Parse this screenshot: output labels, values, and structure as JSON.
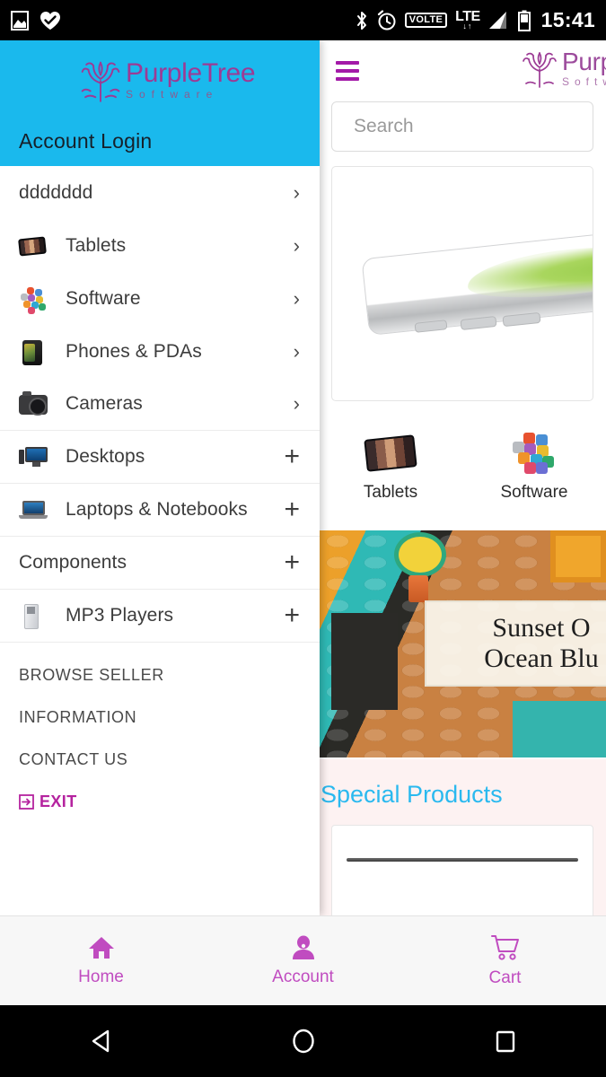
{
  "status_bar": {
    "left_icons": [
      "image-icon",
      "heart-check-icon"
    ],
    "right_icons": [
      "bluetooth-icon",
      "alarm-icon",
      "volte-badge",
      "lte-icon",
      "signal-icon",
      "battery-icon"
    ],
    "volte_label": "VOLTE",
    "lte_label": "LTE",
    "lte_arrows": "↓↑",
    "clock": "15:41"
  },
  "drawer": {
    "logo": {
      "main": "PurpleTree",
      "sub": "Software",
      "icon": "tree-logo-icon"
    },
    "account_login_label": "Account Login",
    "menu_items": [
      {
        "label": "ddddddd",
        "icon": "",
        "action": "chevron",
        "divider": false
      },
      {
        "label": "Tablets",
        "icon": "tablet-thumb-icon",
        "action": "chevron",
        "divider": false
      },
      {
        "label": "Software",
        "icon": "software-thumb-icon",
        "action": "chevron",
        "divider": false
      },
      {
        "label": "Phones & PDAs",
        "icon": "phone-thumb-icon",
        "action": "chevron",
        "divider": false
      },
      {
        "label": "Cameras",
        "icon": "camera-thumb-icon",
        "action": "chevron",
        "divider": true
      },
      {
        "label": "Desktops",
        "icon": "desktop-thumb-icon",
        "action": "plus",
        "divider": true
      },
      {
        "label": "Laptops & Notebooks",
        "icon": "laptop-thumb-icon",
        "action": "plus",
        "divider": true
      },
      {
        "label": "Components",
        "icon": "",
        "action": "plus",
        "divider": true
      },
      {
        "label": "MP3 Players",
        "icon": "mp3-thumb-icon",
        "action": "plus",
        "divider": true
      }
    ],
    "links": [
      "BROWSE SELLER",
      "INFORMATION",
      "CONTACT US"
    ],
    "exit_label": "EXIT",
    "exit_icon": "exit-arrow-icon",
    "header_bg": "#1ab9ed",
    "exit_color": "#b5239f"
  },
  "main": {
    "hamburger_icon": "hamburger-menu-icon",
    "logo": {
      "main": "PurpleTree",
      "sub": "Software",
      "icon": "tree-logo-icon"
    },
    "search": {
      "value": "",
      "placeholder": "Search"
    },
    "hero_image_alt": "white-phone-product-image",
    "categories": [
      {
        "label": "Tablets",
        "icon": "tablet-thumb-icon"
      },
      {
        "label": "Software",
        "icon": "software-thumb-icon"
      }
    ],
    "banner": {
      "line1": "Sunset O",
      "line2": "Ocean Blu",
      "alt": "sunset-ocean-blue-banner"
    },
    "special_section": {
      "title": "Special Products",
      "title_color": "#2ab9ef",
      "background": "#fdf2f2"
    }
  },
  "tab_bar": {
    "items": [
      {
        "label": "Home",
        "icon": "home-icon"
      },
      {
        "label": "Account",
        "icon": "person-icon"
      },
      {
        "label": "Cart",
        "icon": "shopping-cart-icon"
      }
    ],
    "accent_color": "#c04cc0"
  },
  "nav_bar": {
    "buttons": [
      {
        "name": "back-button",
        "icon": "triangle-back-icon"
      },
      {
        "name": "home-button",
        "icon": "circle-home-icon"
      },
      {
        "name": "recents-button",
        "icon": "square-recents-icon"
      }
    ]
  }
}
